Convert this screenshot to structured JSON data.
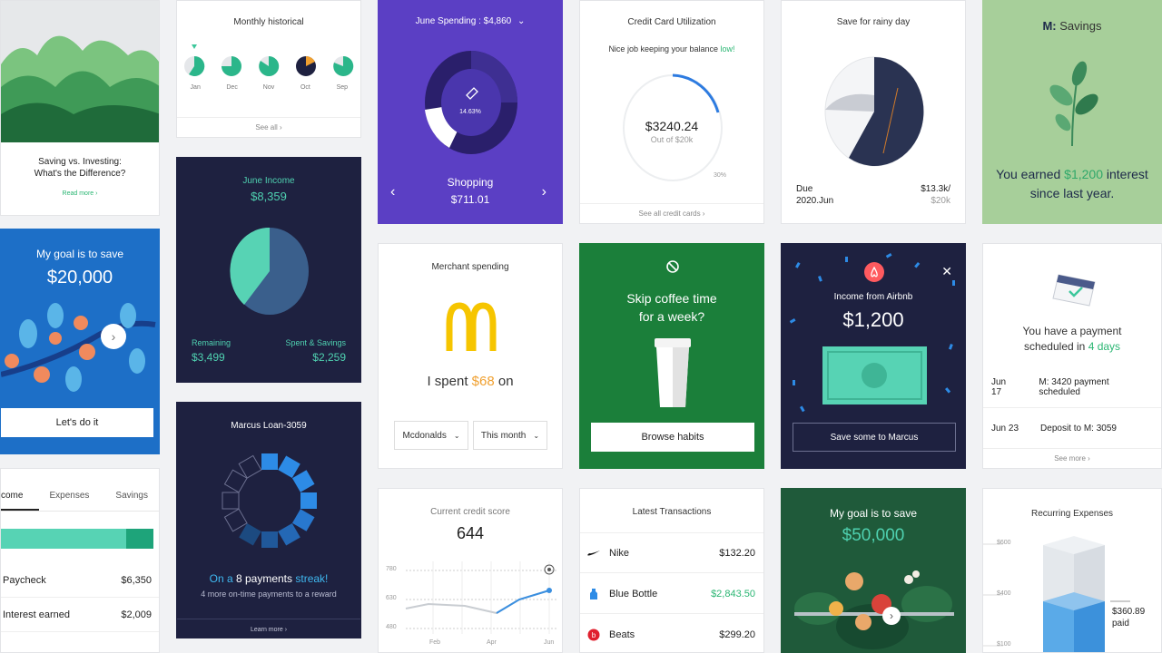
{
  "col1": {
    "article": {
      "title_line1": "Saving vs. Investing:",
      "title_line2": "What's the Difference?",
      "link": "Read more ›"
    },
    "goal": {
      "line1": "My goal is to save",
      "amount": "$20,000",
      "button": "Let's do it"
    },
    "tabs": {
      "items": [
        "come",
        "Expenses",
        "Savings"
      ]
    },
    "income_rows": [
      {
        "label": "Paycheck",
        "value": "$6,350"
      },
      {
        "label": "Interest earned",
        "value": "$2,009"
      }
    ]
  },
  "col2": {
    "historical": {
      "title": "Monthly historical",
      "months": [
        "Jan",
        "Dec",
        "Nov",
        "Oct",
        "Sep"
      ],
      "see_all": "See all ›"
    },
    "income": {
      "title": "June Income",
      "amount": "$8,359",
      "remaining_label": "Remaining",
      "remaining_value": "$3,499",
      "spent_label": "Spent & Savings",
      "spent_value": "$2,259"
    },
    "loan": {
      "title": "Marcus Loan-3059",
      "streak_pre": "On a",
      "streak_num": "8 payments",
      "streak_post": "streak!",
      "sub": "4 more on-time payments to a reward",
      "link": "Learn more ›"
    }
  },
  "col3": {
    "spending": {
      "title": "June Spending : $4,860",
      "chevron": "⌄",
      "pct": "14.63%",
      "category": "Shopping",
      "amount": "$711.01"
    },
    "merchant": {
      "title": "Merchant spending",
      "text_pre": "I spent",
      "amount": "$68",
      "text_post": "on",
      "merchant_select": "Mcdonalds",
      "period_select": "This month"
    },
    "credit_score": {
      "title": "Current credit score",
      "score": "644",
      "y_ticks": [
        "780",
        "630",
        "480"
      ],
      "x_ticks": [
        "Feb",
        "Apr",
        "Jun"
      ]
    }
  },
  "col4": {
    "utilization": {
      "title": "Credit Card Utilization",
      "msg_pre": "Nice job keeping your balance",
      "msg_hl": "low!",
      "amount": "$3240.24",
      "sub": "Out of $20k",
      "pct": "30%",
      "see_all": "See all credit cards ›"
    },
    "coffee": {
      "line1": "Skip coffee time",
      "line2": "for a week?",
      "button": "Browse habits"
    },
    "transactions": {
      "title": "Latest Transactions",
      "rows": [
        {
          "name": "Nike",
          "amount": "$132.20"
        },
        {
          "name": "Blue Bottle",
          "amount": "$2,843.50"
        },
        {
          "name": "Beats",
          "amount": "$299.20"
        }
      ]
    }
  },
  "col5": {
    "rainy": {
      "title": "Save for rainy day",
      "due_label": "Due",
      "due_date": "2020.Jun",
      "value1": "$13.3k/",
      "value2": "$20k"
    },
    "airbnb": {
      "title": "Income from Airbnb",
      "amount": "$1,200",
      "button": "Save some to Marcus"
    },
    "goal2": {
      "line1": "My goal is to save",
      "amount": "$50,000"
    }
  },
  "col6": {
    "savings": {
      "brand": "M:",
      "title": "Savings",
      "line1_pre": "You earned",
      "line1_hl": "$1,200",
      "line1_post": "interest",
      "line2": "since last year."
    },
    "payment": {
      "line1": "You have a payment",
      "line2_pre": "scheduled in",
      "line2_hl": "4 days",
      "rows": [
        {
          "date": "Jun 17",
          "desc": "M: 3420 payment scheduled"
        },
        {
          "date": "Jun 23",
          "desc": "Deposit to M: 3059"
        }
      ],
      "see_more": "See more ›"
    },
    "recurring": {
      "title": "Recurring Expenses",
      "ticks": [
        "$600",
        "$400",
        "$100"
      ],
      "paid_value": "$360.89",
      "paid_label": "paid"
    }
  },
  "colors": {
    "teal": "#4fd1b0",
    "navy": "#1e2140",
    "purple": "#5b3fc4",
    "blue": "#1d6fc7",
    "green": "#1b7f3a",
    "darkgreen": "#1f5a3a",
    "mint": "#a7cf9a"
  }
}
